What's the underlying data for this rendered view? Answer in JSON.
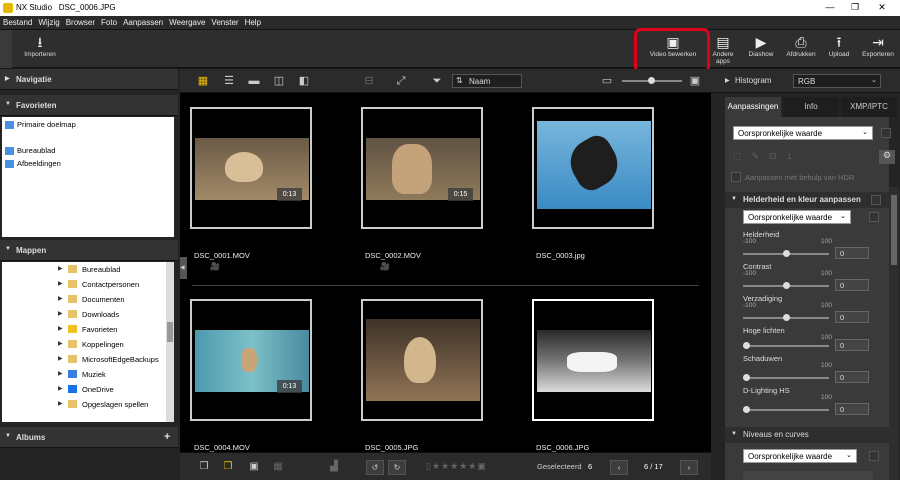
{
  "window": {
    "app": "NX Studio",
    "file": "DSC_0006.JPG"
  },
  "menu": [
    "Bestand",
    "Wijzig",
    "Browser",
    "Foto",
    "Aanpassen",
    "Weergave",
    "Venster",
    "Help"
  ],
  "toolbar": {
    "import": "Importeren",
    "video_edit": "Video bewerken",
    "other_apps": "Andere apps",
    "slideshow": "Diashow",
    "print": "Afdrukken",
    "upload": "Upload",
    "export": "Exporteren"
  },
  "left": {
    "nav": "Navigatie",
    "favorites": "Favorieten",
    "fav_items": [
      "Primaire doelmap",
      "Bureaublad",
      "Afbeeldingen"
    ],
    "folders": "Mappen",
    "folder_items": [
      "Bureaublad",
      "Contactpersonen",
      "Documenten",
      "Downloads",
      "Favorieten",
      "Koppelingen",
      "MicrosoftEdgeBackups",
      "Muziek",
      "OneDrive",
      "Opgeslagen spellen"
    ],
    "albums": "Albums"
  },
  "center": {
    "sort": "Naam",
    "items": [
      {
        "name": "DSC_0001.MOV",
        "duration": "0:13",
        "video": true
      },
      {
        "name": "DSC_0002.MOV",
        "duration": "0:15",
        "video": true
      },
      {
        "name": "DSC_0003.jpg",
        "duration": "",
        "video": false
      },
      {
        "name": "DSC_0004.MOV",
        "duration": "0:13",
        "video": true
      },
      {
        "name": "DSC_0005.JPG",
        "duration": "",
        "video": false
      },
      {
        "name": "DSC_0006.JPG",
        "duration": "",
        "video": false
      }
    ],
    "selected_label": "Geselecteerd",
    "selected_count": "6",
    "page": "6 / 17"
  },
  "right": {
    "histogram": "Histogram",
    "histogram_mode": "RGB",
    "tabs": [
      "Aanpassingen",
      "Info",
      "XMP/IPTC"
    ],
    "preset": "Oorspronkelijke waarde",
    "hdr": "Aanpassen met behulp van HDR",
    "section1": "Helderheid en kleur aanpassen",
    "section1_preset": "Oorspronkelijke waarde",
    "sliders": [
      {
        "label": "Helderheid",
        "min": "-100",
        "max": "100",
        "value": "0"
      },
      {
        "label": "Contrast",
        "min": "-100",
        "max": "100",
        "value": "0"
      },
      {
        "label": "Verzadiging",
        "min": "-100",
        "max": "100",
        "value": "0"
      },
      {
        "label": "Hoge lichten",
        "min": "",
        "max": "100",
        "value": "0"
      },
      {
        "label": "Schaduwen",
        "min": "",
        "max": "100",
        "value": "0"
      },
      {
        "label": "D-Lighting HS",
        "min": "",
        "max": "100",
        "value": "0"
      }
    ],
    "section2": "Niveaus en curves",
    "section2_preset": "Oorspronkelijke waarde"
  }
}
